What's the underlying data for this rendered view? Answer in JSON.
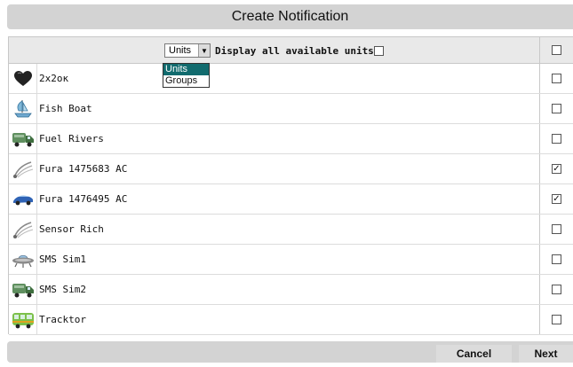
{
  "dialog": {
    "title": "Create Notification"
  },
  "filter": {
    "selected": "Units",
    "display_all_label": "Display all available units",
    "options": [
      "Units",
      "Groups"
    ]
  },
  "units": [
    {
      "name": "2x2ок",
      "icon": "heart-icon",
      "checked": false
    },
    {
      "name": "Fish Boat",
      "icon": "boat-icon",
      "checked": false
    },
    {
      "name": "Fuel Rivers",
      "icon": "truck-icon",
      "checked": false
    },
    {
      "name": "Fura 1475683 AC",
      "icon": "satellite-icon",
      "checked": true
    },
    {
      "name": "Fura 1476495 AC",
      "icon": "car-icon",
      "checked": true
    },
    {
      "name": "Sensor Rich",
      "icon": "satellite-icon",
      "checked": false
    },
    {
      "name": "SMS Sim1",
      "icon": "ufo-icon",
      "checked": false
    },
    {
      "name": "SMS Sim2",
      "icon": "truck-icon",
      "checked": false
    },
    {
      "name": "Tracktor",
      "icon": "bus-icon",
      "checked": false
    }
  ],
  "buttons": {
    "cancel": "Cancel",
    "next": "Next"
  },
  "colors": {
    "selected_option": "#116b6e",
    "bar": "#d3d3d3"
  }
}
